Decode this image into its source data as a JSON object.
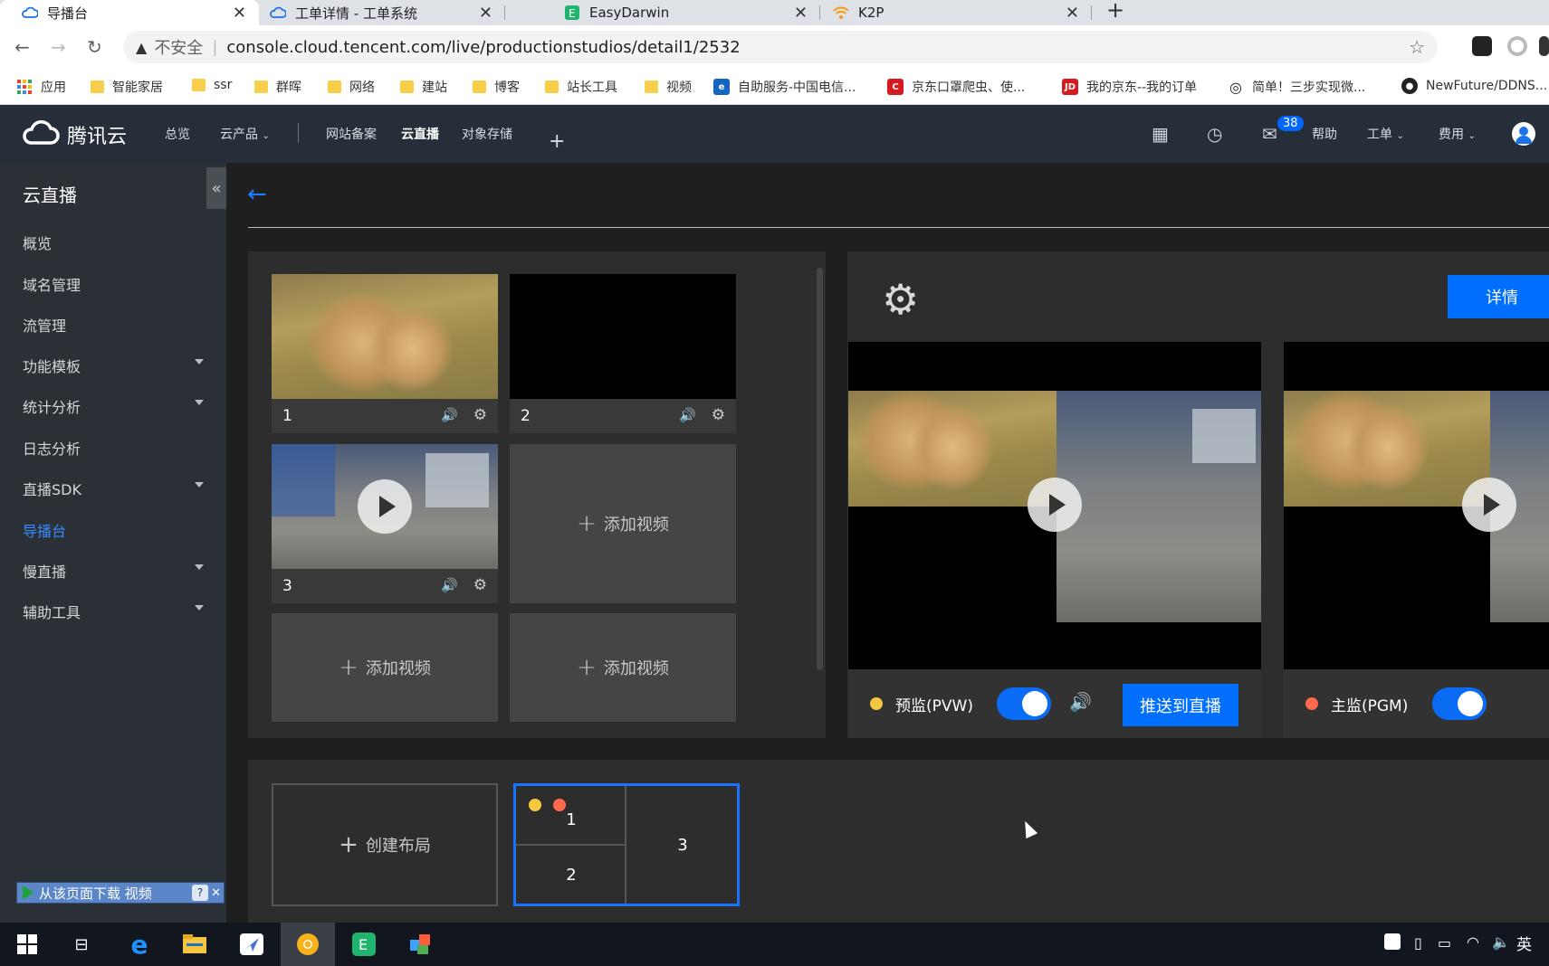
{
  "browser": {
    "tabs": [
      {
        "title": "导播台",
        "active": true,
        "icon": "tencent-cloud-icon"
      },
      {
        "title": "工单详情 - 工单系统",
        "active": false,
        "icon": "tencent-cloud-icon"
      },
      {
        "title": "EasyDarwin",
        "active": false,
        "icon": "easydarwin-icon"
      },
      {
        "title": "K2P",
        "active": false,
        "icon": "wifi-icon"
      }
    ],
    "address": {
      "insecure_label": "不安全",
      "url": "console.cloud.tencent.com/live/productionstudios/detail1/2532"
    },
    "bookmarks": [
      {
        "label": "应用",
        "icon": "apps-grid-icon"
      },
      {
        "label": "智能家居",
        "icon": "folder-icon"
      },
      {
        "label": "ssr",
        "icon": "folder-icon"
      },
      {
        "label": "群晖",
        "icon": "folder-icon"
      },
      {
        "label": "网络",
        "icon": "folder-icon"
      },
      {
        "label": "建站",
        "icon": "folder-icon"
      },
      {
        "label": "博客",
        "icon": "folder-icon"
      },
      {
        "label": "站长工具",
        "icon": "folder-icon"
      },
      {
        "label": "视频",
        "icon": "folder-icon"
      },
      {
        "label": "自助服务-中国电信...",
        "icon": "china-telecom-icon"
      },
      {
        "label": "京东口罩爬虫、使...",
        "icon": "csdn-icon"
      },
      {
        "label": "我的京东--我的订单",
        "icon": "jd-icon"
      },
      {
        "label": "简单！三步实现微...",
        "icon": "target-icon"
      },
      {
        "label": "NewFuture/DDNS...",
        "icon": "github-icon"
      }
    ]
  },
  "header": {
    "brand": "腾讯云",
    "nav": [
      {
        "label": "总览"
      },
      {
        "label": "云产品"
      },
      {
        "label": "网站备案"
      },
      {
        "label": "云直播"
      },
      {
        "label": "对象存储"
      }
    ],
    "add": "+",
    "mail_badge": "38",
    "right": [
      {
        "label": "帮助"
      },
      {
        "label": "工单"
      },
      {
        "label": "费用"
      }
    ]
  },
  "sidebar": {
    "title": "云直播",
    "items": [
      {
        "label": "概览",
        "has_caret": false
      },
      {
        "label": "域名管理",
        "has_caret": false
      },
      {
        "label": "流管理",
        "has_caret": false
      },
      {
        "label": "功能模板",
        "has_caret": true
      },
      {
        "label": "统计分析",
        "has_caret": true
      },
      {
        "label": "日志分析",
        "has_caret": false
      },
      {
        "label": "直播SDK",
        "has_caret": true
      },
      {
        "label": "导播台",
        "has_caret": false,
        "active": true
      },
      {
        "label": "慢直播",
        "has_caret": true
      },
      {
        "label": "辅助工具",
        "has_caret": true
      }
    ],
    "download_bar": "从该页面下载 视频",
    "download_help": "?"
  },
  "sources": [
    {
      "num": "1",
      "kind": "lion"
    },
    {
      "num": "2",
      "kind": "black"
    },
    {
      "num": "3",
      "kind": "warehouse"
    }
  ],
  "add_video_label": "添加视频",
  "monitors": {
    "details_label": "详情",
    "preview_label": "预监(PVW)",
    "program_label": "主监(PGM)",
    "push_label": "推送到直播",
    "colors": {
      "preview_dot": "#f5c842",
      "program_dot": "#ff6a4d",
      "accent": "#006eff"
    }
  },
  "layouts": {
    "create_label": "创建布局",
    "cells": [
      "1",
      "2",
      "3"
    ]
  },
  "taskbar": {
    "input_method": "英"
  }
}
